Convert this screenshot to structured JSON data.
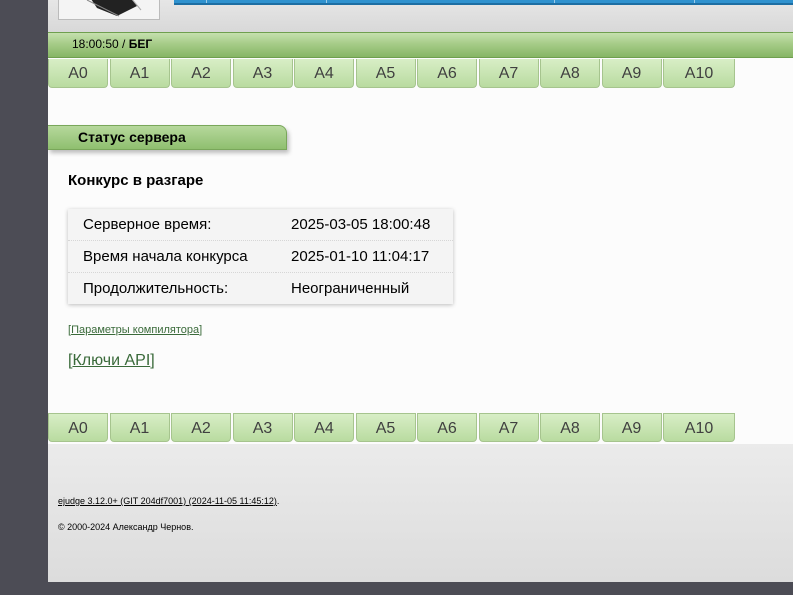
{
  "status_bar": {
    "time": "18:00:50",
    "separator": " / ",
    "state": "БЕГ"
  },
  "menu": [
    "A0",
    "A1",
    "A2",
    "A3",
    "A4",
    "A5",
    "A6",
    "A7",
    "A8",
    "A9",
    "A10"
  ],
  "section_title": "Статус сервера",
  "contest_state": "Конкурс в разгаре",
  "info": {
    "rows": [
      {
        "label": "Серверное время:",
        "value": "2025-03-05 18:00:48"
      },
      {
        "label": "Время начала конкурса",
        "value": "2025-01-10 11:04:17"
      },
      {
        "label": "Продолжительность:",
        "value": "Неограниченный"
      }
    ]
  },
  "links": {
    "compiler_bracket_open": "[",
    "compiler": "Параметры компилятора",
    "compiler_bracket_close": "]",
    "api_bracket_open": "[",
    "api": "Ключи API",
    "api_bracket_close": "]"
  },
  "footer": {
    "version_link": "ejudge 3.12.0+ (GIT 204df7001) (2024-11-05 11:45:12)",
    "version_tail": ".",
    "copyright": "© 2000-2024 Александр Чернов."
  },
  "colors": {
    "accent_green": "#a6cc88",
    "top_blue": "#2f92cf",
    "link": "#3a6a3a"
  }
}
